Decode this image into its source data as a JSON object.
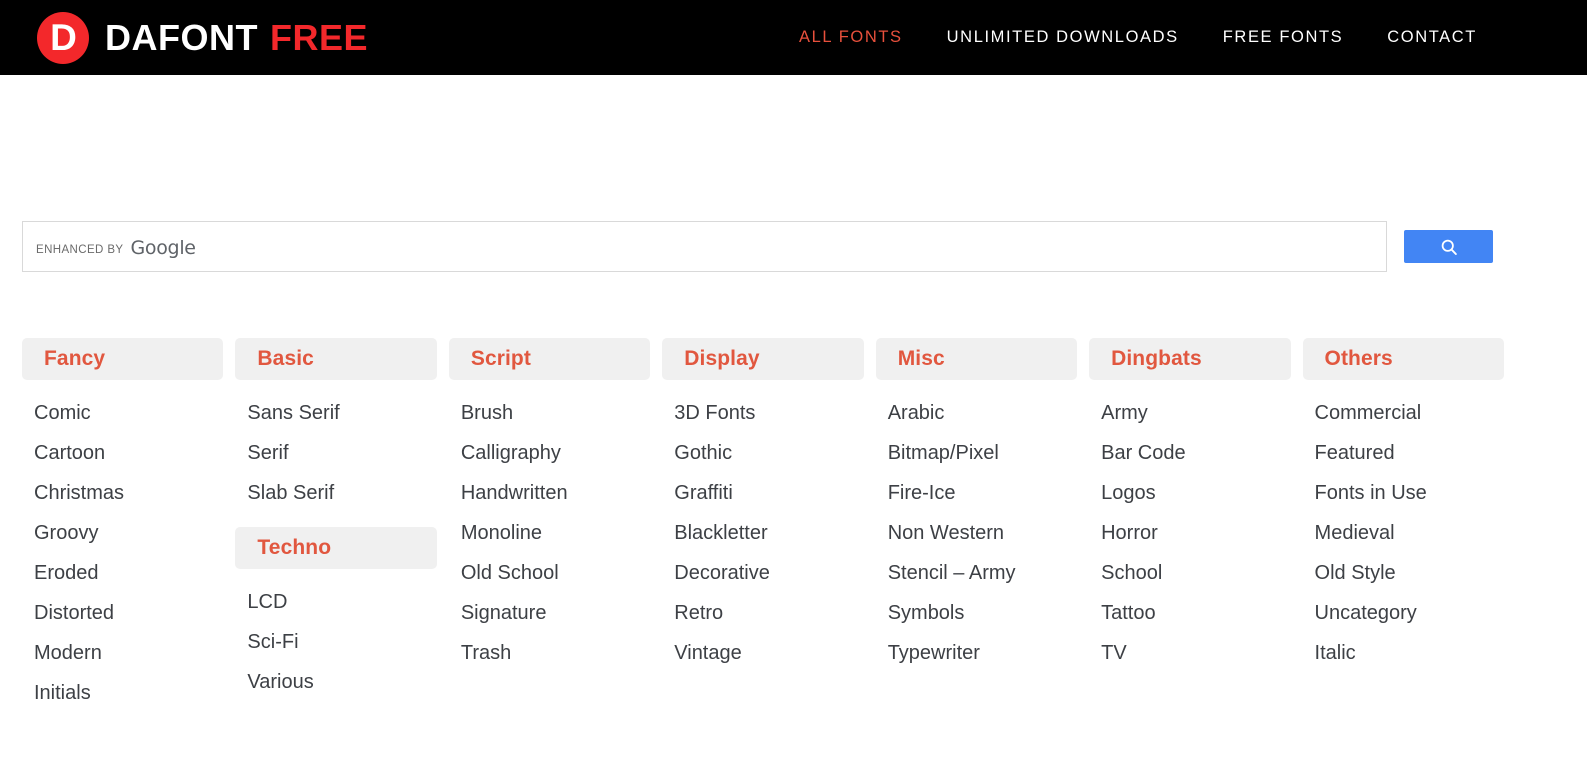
{
  "header": {
    "brand": {
      "mark_letter": "D",
      "word1": "DAFONT",
      "word2": "FREE"
    },
    "nav": [
      {
        "label": "ALL FONTS",
        "active": true
      },
      {
        "label": "UNLIMITED DOWNLOADS",
        "active": false
      },
      {
        "label": "FREE FONTS",
        "active": false
      },
      {
        "label": "CONTACT",
        "active": false
      }
    ]
  },
  "search": {
    "branding_prefix": "ENHANCED BY",
    "branding_brand": "Google",
    "input_value": "",
    "input_placeholder": "",
    "button_icon": "search-icon"
  },
  "colors": {
    "brand_red": "#f3282b",
    "accent": "#e1573f",
    "header_bg": "#000000",
    "chip_bg": "#f0f0f0",
    "link_text": "#3d4045",
    "google_blue": "#4285f4"
  },
  "columns": [
    {
      "title": "Fancy",
      "items": [
        "Comic",
        "Cartoon",
        "Christmas",
        "Groovy",
        "Eroded",
        "Distorted",
        "Modern",
        "Initials"
      ]
    },
    {
      "title": "Basic",
      "items": [
        "Sans Serif",
        "Serif",
        "Slab Serif"
      ],
      "sub_title": "Techno",
      "sub_items": [
        "LCD",
        "Sci-Fi",
        "Various"
      ]
    },
    {
      "title": "Script",
      "items": [
        "Brush",
        "Calligraphy",
        "Handwritten",
        "Monoline",
        "Old School",
        "Signature",
        "Trash"
      ]
    },
    {
      "title": "Display",
      "items": [
        "3D Fonts",
        "Gothic",
        "Graffiti",
        "Blackletter",
        "Decorative",
        "Retro",
        "Vintage"
      ]
    },
    {
      "title": "Misc",
      "items": [
        "Arabic",
        "Bitmap/Pixel",
        "Fire-Ice",
        "Non Western",
        "Stencil – Army",
        "Symbols",
        "Typewriter"
      ]
    },
    {
      "title": "Dingbats",
      "items": [
        "Army",
        "Bar Code",
        "Logos",
        "Horror",
        "School",
        "Tattoo",
        "TV"
      ]
    },
    {
      "title": "Others",
      "items": [
        "Commercial",
        "Featured",
        "Fonts in Use",
        "Medieval",
        "Old Style",
        "Uncategory",
        "Italic"
      ]
    }
  ]
}
